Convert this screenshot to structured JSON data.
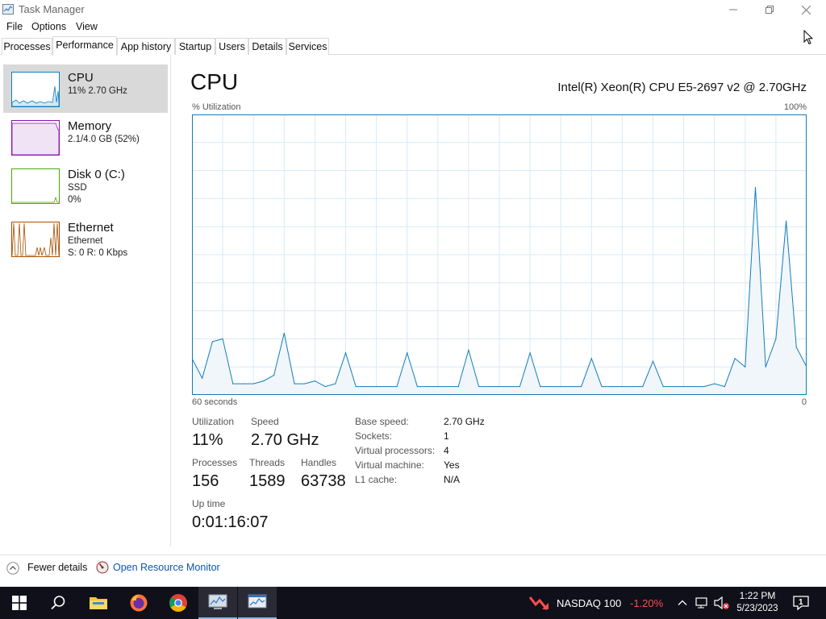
{
  "window": {
    "title": "Task Manager"
  },
  "menu": [
    "File",
    "Options",
    "View"
  ],
  "tabs": [
    "Processes",
    "Performance",
    "App history",
    "Startup",
    "Users",
    "Details",
    "Services"
  ],
  "active_tab": "Performance",
  "sidebar": {
    "items": [
      {
        "title": "CPU",
        "sub1": "11% 2.70 GHz",
        "sub2": "",
        "color": "#117dbb"
      },
      {
        "title": "Memory",
        "sub1": "2.1/4.0 GB (52%)",
        "sub2": "",
        "color": "#8b12ae"
      },
      {
        "title": "Disk 0 (C:)",
        "sub1": "SSD",
        "sub2": "0%",
        "color": "#4da60c"
      },
      {
        "title": "Ethernet",
        "sub1": "Ethernet",
        "sub2": "S: 0 R: 0 Kbps",
        "color": "#a74f01"
      }
    ]
  },
  "main": {
    "title": "CPU",
    "model": "Intel(R) Xeon(R) CPU E5-2697 v2 @ 2.70GHz",
    "graph_top_left": "% Utilization",
    "graph_top_right": "100%",
    "graph_bottom_left": "60 seconds",
    "graph_bottom_right": "0",
    "stats": {
      "utilization_label": "Utilization",
      "utilization_value": "11%",
      "speed_label": "Speed",
      "speed_value": "2.70 GHz",
      "processes_label": "Processes",
      "processes_value": "156",
      "threads_label": "Threads",
      "threads_value": "1589",
      "handles_label": "Handles",
      "handles_value": "63738",
      "uptime_label": "Up time",
      "uptime_value": "0:01:16:07"
    },
    "details": [
      {
        "key": "Base speed:",
        "value": "2.70 GHz"
      },
      {
        "key": "Sockets:",
        "value": "1"
      },
      {
        "key": "Virtual processors:",
        "value": "4"
      },
      {
        "key": "Virtual machine:",
        "value": "Yes"
      },
      {
        "key": "L1 cache:",
        "value": "N/A"
      }
    ]
  },
  "chart_data": {
    "type": "area",
    "xlim": [
      60,
      0
    ],
    "ylim": [
      0,
      100
    ],
    "grid": true,
    "color": "#117dbb",
    "x": [
      60,
      59,
      58,
      57,
      56,
      55,
      54,
      53,
      52,
      51,
      50,
      49,
      48,
      47,
      46,
      45,
      44,
      43,
      42,
      41,
      40,
      39,
      38,
      37,
      36,
      35,
      34,
      33,
      32,
      31,
      30,
      29,
      28,
      27,
      26,
      25,
      24,
      23,
      22,
      21,
      20,
      19,
      18,
      17,
      16,
      15,
      14,
      13,
      12,
      11,
      10,
      9,
      8,
      7,
      6,
      5,
      4,
      3,
      2,
      1,
      0
    ],
    "values": [
      13,
      6,
      19,
      20,
      4,
      4,
      4,
      5,
      7,
      22,
      4,
      4,
      5,
      3,
      4,
      15,
      3,
      3,
      3,
      3,
      3,
      15,
      3,
      3,
      3,
      3,
      3,
      16,
      3,
      3,
      3,
      3,
      3,
      15,
      3,
      3,
      3,
      3,
      3,
      13,
      3,
      3,
      3,
      3,
      3,
      12,
      3,
      3,
      3,
      3,
      3,
      4,
      3,
      13,
      10,
      74,
      10,
      20,
      62,
      17,
      10
    ]
  },
  "footer": {
    "fewer_details": "Fewer details",
    "open_resource_monitor": "Open Resource Monitor"
  },
  "taskbar": {
    "nasdaq_label": "NASDAQ 100",
    "nasdaq_change": "-1.20%",
    "time": "1:22 PM",
    "date": "5/23/2023",
    "notification_count": "1"
  }
}
